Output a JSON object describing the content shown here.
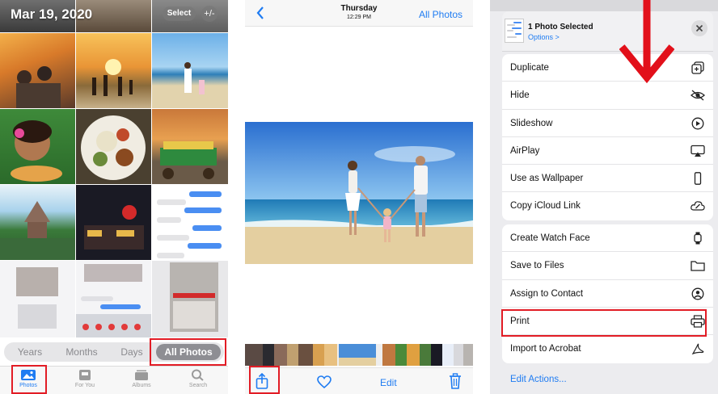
{
  "photos_panel": {
    "date": "Mar 19, 2020",
    "select_label": "Select",
    "zoom_label": "+/-",
    "filters": [
      "Years",
      "Months",
      "Days",
      "All Photos"
    ],
    "active_filter": "All Photos",
    "tabs": [
      {
        "label": "Photos",
        "icon": "photos-icon",
        "active": true
      },
      {
        "label": "For You",
        "icon": "for-you-icon",
        "active": false
      },
      {
        "label": "Albums",
        "icon": "albums-icon",
        "active": false
      },
      {
        "label": "Search",
        "icon": "search-icon",
        "active": false
      }
    ]
  },
  "viewer_panel": {
    "day": "Thursday",
    "time": "12:29 PM",
    "all_photos_link": "All Photos",
    "edit_label": "Edit",
    "toolbar_icons": [
      "share-icon",
      "heart-icon",
      "trash-icon"
    ]
  },
  "share_sheet": {
    "title": "1 Photo Selected",
    "options_link": "Options >",
    "close_icon": "close-icon",
    "group1": [
      {
        "label": "Duplicate",
        "icon": "duplicate-icon"
      },
      {
        "label": "Hide",
        "icon": "eye-slash-icon"
      },
      {
        "label": "Slideshow",
        "icon": "play-circle-icon"
      },
      {
        "label": "AirPlay",
        "icon": "airplay-icon"
      },
      {
        "label": "Use as Wallpaper",
        "icon": "phone-icon"
      },
      {
        "label": "Copy iCloud Link",
        "icon": "cloud-link-icon"
      }
    ],
    "group2": [
      {
        "label": "Create Watch Face",
        "icon": "watch-icon"
      },
      {
        "label": "Save to Files",
        "icon": "folder-icon"
      },
      {
        "label": "Assign to Contact",
        "icon": "contact-icon"
      },
      {
        "label": "Print",
        "icon": "printer-icon"
      },
      {
        "label": "Import to Acrobat",
        "icon": "acrobat-icon"
      }
    ],
    "edit_actions": "Edit Actions..."
  },
  "colors": {
    "ios_blue": "#1f7cf2",
    "highlight_red": "#e21c25",
    "arrow_red": "#e2101a"
  }
}
